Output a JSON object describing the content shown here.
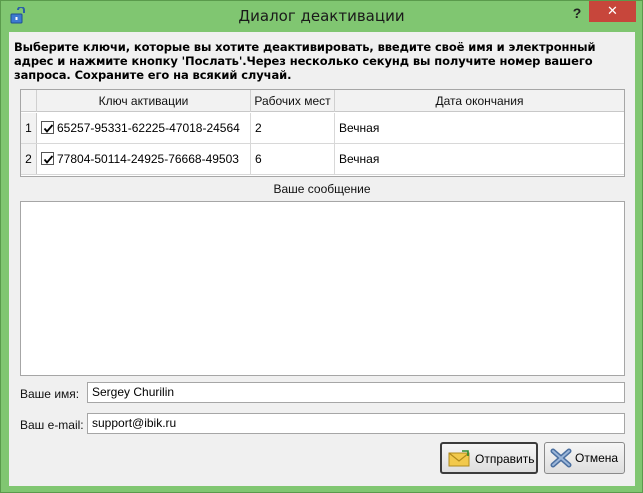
{
  "window": {
    "title": "Диалог деактивации",
    "help_glyph": "?",
    "close_glyph": "✕"
  },
  "intro": "Выберите ключи, которые вы хотите деактивировать, введите своё имя и электронный адрес и нажмите кнопку 'Послать'.Через несколько секунд вы получите номер вашего запроса. Сохраните его на всякий случай.",
  "table": {
    "columns": [
      "Ключ активации",
      "Рабочих мест",
      "Дата окончания"
    ],
    "rows": [
      {
        "num": "1",
        "checked": true,
        "key": "65257-95331-62225-47018-24564",
        "seats": "2",
        "expires": "Вечная"
      },
      {
        "num": "2",
        "checked": true,
        "key": "77804-50114-24925-76668-49503",
        "seats": "6",
        "expires": "Вечная"
      }
    ]
  },
  "message": {
    "label": "Ваше сообщение",
    "value": ""
  },
  "form": {
    "name_label": "Ваше имя:",
    "name_value": "Sergey Churilin",
    "email_label": "Ваш e-mail:",
    "email_value": "support@ibik.ru"
  },
  "buttons": {
    "send_label": "Отправить",
    "cancel_label": "Отмена"
  },
  "icons": {
    "app": "unlock-icon",
    "send": "envelope-icon",
    "cancel": "cross-icon"
  },
  "colors": {
    "titlebar": "#80c671",
    "close": "#c7463b",
    "client": "#f0f0f0"
  }
}
